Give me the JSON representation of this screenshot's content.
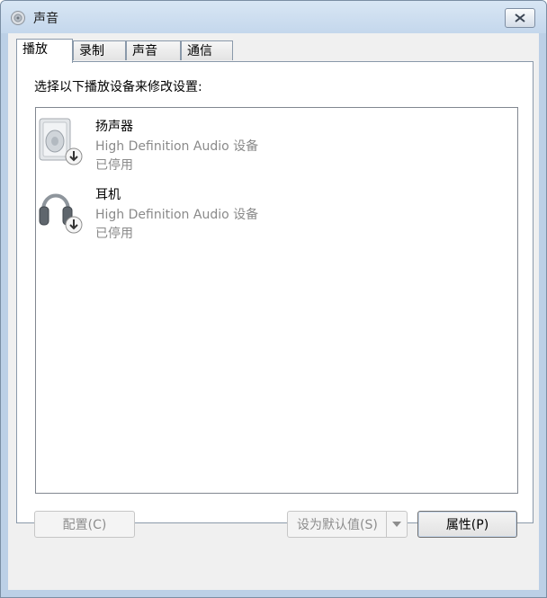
{
  "window": {
    "title": "声音"
  },
  "tabs": [
    "播放",
    "录制",
    "声音",
    "通信"
  ],
  "panel": {
    "prompt": "选择以下播放设备来修改设置:"
  },
  "devices": [
    {
      "name": "扬声器",
      "description": "High Definition Audio 设备",
      "status": "已停用",
      "icon": "speaker-icon"
    },
    {
      "name": "耳机",
      "description": "High Definition Audio 设备",
      "status": "已停用",
      "icon": "headphones-icon"
    }
  ],
  "buttons": {
    "configure": "配置(C)",
    "set_default": "设为默认值(S)",
    "properties": "属性(P)"
  }
}
